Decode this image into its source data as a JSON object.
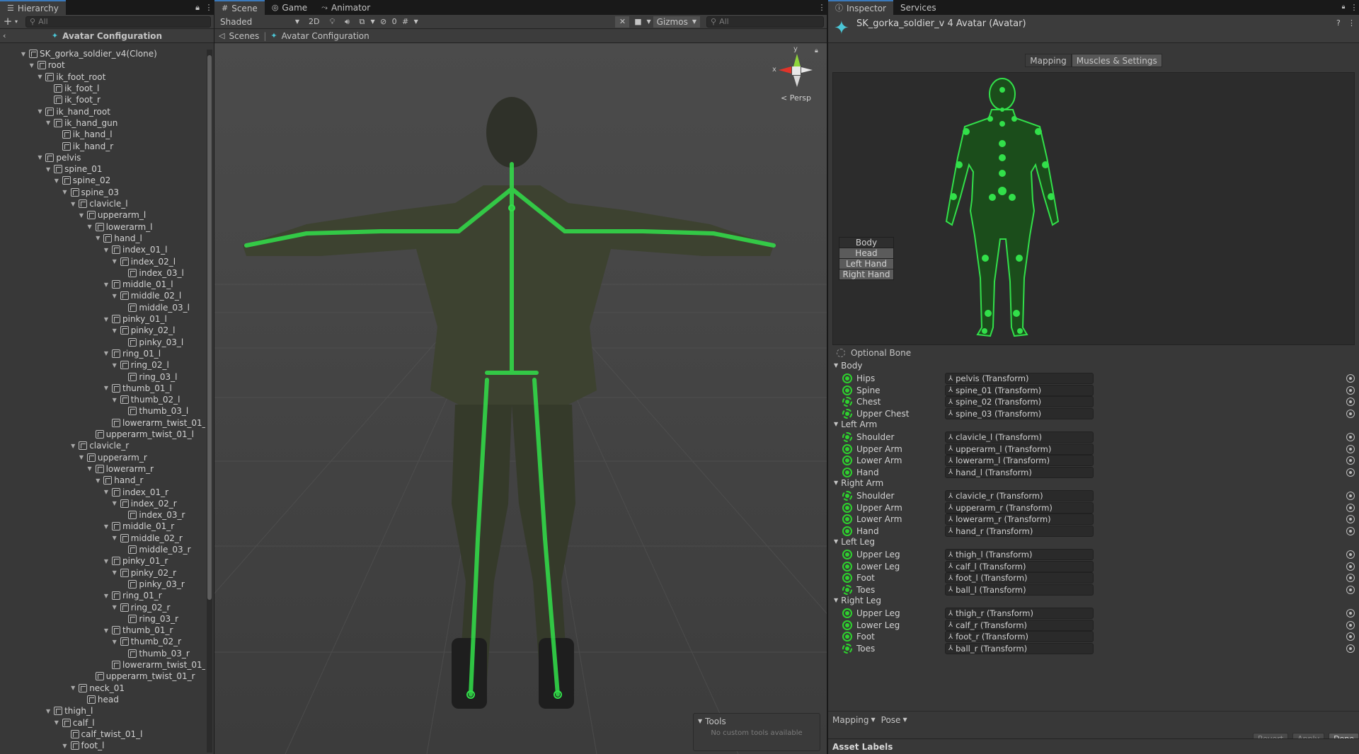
{
  "hierarchy": {
    "tab_label": "Hierarchy",
    "search_placeholder": "All",
    "add_label": "+",
    "avatar_config_label": "Avatar Configuration",
    "tree": [
      {
        "label": "SK_gorka_soldier_v4(Clone)",
        "depth": 0,
        "arrow": "▼"
      },
      {
        "label": "root",
        "depth": 1,
        "arrow": "▼"
      },
      {
        "label": "ik_foot_root",
        "depth": 2,
        "arrow": "▼"
      },
      {
        "label": "ik_foot_l",
        "depth": 3,
        "arrow": ""
      },
      {
        "label": "ik_foot_r",
        "depth": 3,
        "arrow": ""
      },
      {
        "label": "ik_hand_root",
        "depth": 2,
        "arrow": "▼"
      },
      {
        "label": "ik_hand_gun",
        "depth": 3,
        "arrow": "▼"
      },
      {
        "label": "ik_hand_l",
        "depth": 4,
        "arrow": ""
      },
      {
        "label": "ik_hand_r",
        "depth": 4,
        "arrow": ""
      },
      {
        "label": "pelvis",
        "depth": 2,
        "arrow": "▼"
      },
      {
        "label": "spine_01",
        "depth": 3,
        "arrow": "▼"
      },
      {
        "label": "spine_02",
        "depth": 4,
        "arrow": "▼"
      },
      {
        "label": "spine_03",
        "depth": 5,
        "arrow": "▼"
      },
      {
        "label": "clavicle_l",
        "depth": 6,
        "arrow": "▼"
      },
      {
        "label": "upperarm_l",
        "depth": 7,
        "arrow": "▼"
      },
      {
        "label": "lowerarm_l",
        "depth": 8,
        "arrow": "▼"
      },
      {
        "label": "hand_l",
        "depth": 9,
        "arrow": "▼"
      },
      {
        "label": "index_01_l",
        "depth": 10,
        "arrow": "▼"
      },
      {
        "label": "index_02_l",
        "depth": 11,
        "arrow": "▼"
      },
      {
        "label": "index_03_l",
        "depth": 12,
        "arrow": ""
      },
      {
        "label": "middle_01_l",
        "depth": 10,
        "arrow": "▼"
      },
      {
        "label": "middle_02_l",
        "depth": 11,
        "arrow": "▼"
      },
      {
        "label": "middle_03_l",
        "depth": 12,
        "arrow": ""
      },
      {
        "label": "pinky_01_l",
        "depth": 10,
        "arrow": "▼"
      },
      {
        "label": "pinky_02_l",
        "depth": 11,
        "arrow": "▼"
      },
      {
        "label": "pinky_03_l",
        "depth": 12,
        "arrow": ""
      },
      {
        "label": "ring_01_l",
        "depth": 10,
        "arrow": "▼"
      },
      {
        "label": "ring_02_l",
        "depth": 11,
        "arrow": "▼"
      },
      {
        "label": "ring_03_l",
        "depth": 12,
        "arrow": ""
      },
      {
        "label": "thumb_01_l",
        "depth": 10,
        "arrow": "▼"
      },
      {
        "label": "thumb_02_l",
        "depth": 11,
        "arrow": "▼"
      },
      {
        "label": "thumb_03_l",
        "depth": 12,
        "arrow": ""
      },
      {
        "label": "lowerarm_twist_01_l",
        "depth": 10,
        "arrow": ""
      },
      {
        "label": "upperarm_twist_01_l",
        "depth": 8,
        "arrow": ""
      },
      {
        "label": "clavicle_r",
        "depth": 6,
        "arrow": "▼"
      },
      {
        "label": "upperarm_r",
        "depth": 7,
        "arrow": "▼"
      },
      {
        "label": "lowerarm_r",
        "depth": 8,
        "arrow": "▼"
      },
      {
        "label": "hand_r",
        "depth": 9,
        "arrow": "▼"
      },
      {
        "label": "index_01_r",
        "depth": 10,
        "arrow": "▼"
      },
      {
        "label": "index_02_r",
        "depth": 11,
        "arrow": "▼"
      },
      {
        "label": "index_03_r",
        "depth": 12,
        "arrow": ""
      },
      {
        "label": "middle_01_r",
        "depth": 10,
        "arrow": "▼"
      },
      {
        "label": "middle_02_r",
        "depth": 11,
        "arrow": "▼"
      },
      {
        "label": "middle_03_r",
        "depth": 12,
        "arrow": ""
      },
      {
        "label": "pinky_01_r",
        "depth": 10,
        "arrow": "▼"
      },
      {
        "label": "pinky_02_r",
        "depth": 11,
        "arrow": "▼"
      },
      {
        "label": "pinky_03_r",
        "depth": 12,
        "arrow": ""
      },
      {
        "label": "ring_01_r",
        "depth": 10,
        "arrow": "▼"
      },
      {
        "label": "ring_02_r",
        "depth": 11,
        "arrow": "▼"
      },
      {
        "label": "ring_03_r",
        "depth": 12,
        "arrow": ""
      },
      {
        "label": "thumb_01_r",
        "depth": 10,
        "arrow": "▼"
      },
      {
        "label": "thumb_02_r",
        "depth": 11,
        "arrow": "▼"
      },
      {
        "label": "thumb_03_r",
        "depth": 12,
        "arrow": ""
      },
      {
        "label": "lowerarm_twist_01_r",
        "depth": 10,
        "arrow": ""
      },
      {
        "label": "upperarm_twist_01_r",
        "depth": 8,
        "arrow": ""
      },
      {
        "label": "neck_01",
        "depth": 6,
        "arrow": "▼"
      },
      {
        "label": "head",
        "depth": 7,
        "arrow": ""
      },
      {
        "label": "thigh_l",
        "depth": 3,
        "arrow": "▼"
      },
      {
        "label": "calf_l",
        "depth": 4,
        "arrow": "▼"
      },
      {
        "label": "calf_twist_01_l",
        "depth": 5,
        "arrow": ""
      },
      {
        "label": "foot_l",
        "depth": 5,
        "arrow": "▼"
      }
    ]
  },
  "scene": {
    "tabs": [
      {
        "label": "Scene",
        "icon": "grid-icon",
        "active": true
      },
      {
        "label": "Game",
        "icon": "gamepad-icon",
        "active": false
      },
      {
        "label": "Animator",
        "icon": "animator-icon",
        "active": false
      }
    ],
    "shading_mode": "Shaded",
    "mode_2d": "2D",
    "fx_count": "0",
    "gizmos_label": "Gizmos",
    "search_placeholder": "All",
    "breadcrumb_scenes": "Scenes",
    "breadcrumb_current": "Avatar Configuration",
    "persp_label": "Persp",
    "axis_y": "y",
    "axis_x": "x",
    "tools_title": "Tools",
    "tools_empty": "No custom tools available"
  },
  "inspector": {
    "tabs": [
      {
        "label": "Inspector",
        "active": true
      },
      {
        "label": "Services",
        "active": false
      }
    ],
    "title": "SK_gorka_soldier_v 4 Avatar (Avatar)",
    "mapping_tab": "Mapping",
    "muscles_tab": "Muscles & Settings",
    "body_buttons": [
      {
        "label": "Body",
        "selected": false
      },
      {
        "label": "Head",
        "selected": true
      },
      {
        "label": "Left Hand",
        "selected": true
      },
      {
        "label": "Right Hand",
        "selected": true
      }
    ],
    "optional_bone": "Optional Bone",
    "groups": [
      {
        "title": "Body",
        "bones": [
          {
            "name": "Hips",
            "value": "pelvis (Transform)",
            "optional": false
          },
          {
            "name": "Spine",
            "value": "spine_01 (Transform)",
            "optional": false
          },
          {
            "name": "Chest",
            "value": "spine_02 (Transform)",
            "optional": true
          },
          {
            "name": "Upper Chest",
            "value": "spine_03 (Transform)",
            "optional": true
          }
        ]
      },
      {
        "title": "Left Arm",
        "bones": [
          {
            "name": "Shoulder",
            "value": "clavicle_l (Transform)",
            "optional": true
          },
          {
            "name": "Upper Arm",
            "value": "upperarm_l (Transform)",
            "optional": false
          },
          {
            "name": "Lower Arm",
            "value": "lowerarm_l (Transform)",
            "optional": false
          },
          {
            "name": "Hand",
            "value": "hand_l (Transform)",
            "optional": false
          }
        ]
      },
      {
        "title": "Right Arm",
        "bones": [
          {
            "name": "Shoulder",
            "value": "clavicle_r (Transform)",
            "optional": true
          },
          {
            "name": "Upper Arm",
            "value": "upperarm_r (Transform)",
            "optional": false
          },
          {
            "name": "Lower Arm",
            "value": "lowerarm_r (Transform)",
            "optional": false
          },
          {
            "name": "Hand",
            "value": "hand_r (Transform)",
            "optional": false
          }
        ]
      },
      {
        "title": "Left Leg",
        "bones": [
          {
            "name": "Upper Leg",
            "value": "thigh_l (Transform)",
            "optional": false
          },
          {
            "name": "Lower Leg",
            "value": "calf_l (Transform)",
            "optional": false
          },
          {
            "name": "Foot",
            "value": "foot_l (Transform)",
            "optional": false
          },
          {
            "name": "Toes",
            "value": "ball_l (Transform)",
            "optional": true
          }
        ]
      },
      {
        "title": "Right Leg",
        "bones": [
          {
            "name": "Upper Leg",
            "value": "thigh_r (Transform)",
            "optional": false
          },
          {
            "name": "Lower Leg",
            "value": "calf_r (Transform)",
            "optional": false
          },
          {
            "name": "Foot",
            "value": "foot_r (Transform)",
            "optional": false
          },
          {
            "name": "Toes",
            "value": "ball_r (Transform)",
            "optional": true
          }
        ]
      }
    ],
    "mapping_dropdown": "Mapping",
    "pose_dropdown": "Pose",
    "revert_label": "Revert",
    "apply_label": "Apply",
    "done_label": "Done",
    "asset_labels": "Asset Labels"
  },
  "colors": {
    "bone_green": "#2ed12e",
    "accent_blue": "#3a79bb",
    "panel_bg": "#383838",
    "viewport_bg": "#474747"
  }
}
